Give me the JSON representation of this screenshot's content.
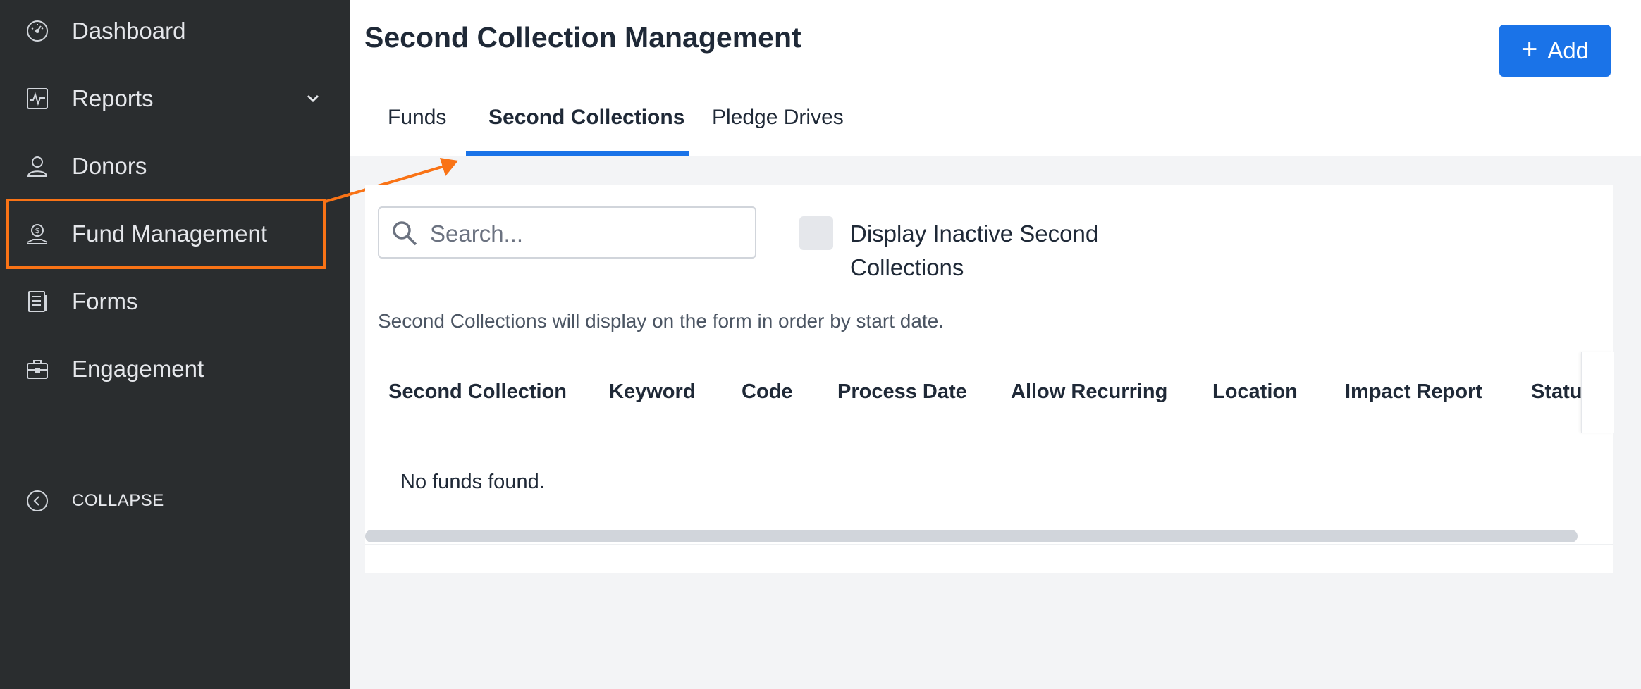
{
  "sidebar": {
    "items": [
      {
        "label": "Dashboard",
        "icon": "dashboard-gauge-icon"
      },
      {
        "label": "Reports",
        "icon": "reports-chart-icon"
      },
      {
        "label": "Donors",
        "icon": "donors-person-icon"
      },
      {
        "label": "Fund Management",
        "icon": "fund-management-icon"
      },
      {
        "label": "Forms",
        "icon": "forms-document-icon"
      },
      {
        "label": "Engagement",
        "icon": "engagement-briefcase-icon"
      }
    ],
    "collapse_label": "COLLAPSE"
  },
  "header": {
    "title": "Second Collection Management",
    "add_label": "Add"
  },
  "tabs": [
    {
      "label": "Funds"
    },
    {
      "label": "Second Collections"
    },
    {
      "label": "Pledge Drives"
    }
  ],
  "filters": {
    "search_placeholder": "Search...",
    "checkbox_label": "Display Inactive Second Collections"
  },
  "info_text": "Second Collections will display on the form in order by start date.",
  "table": {
    "columns": [
      "Second Collection",
      "Keyword",
      "Code",
      "Process Date",
      "Allow Recurring",
      "Location",
      "Impact Report",
      "Status"
    ],
    "empty_text": "No funds found."
  },
  "colors": {
    "sidebar_bg": "#2a2d2f",
    "accent": "#1a73e8",
    "annotation": "#f97316"
  }
}
